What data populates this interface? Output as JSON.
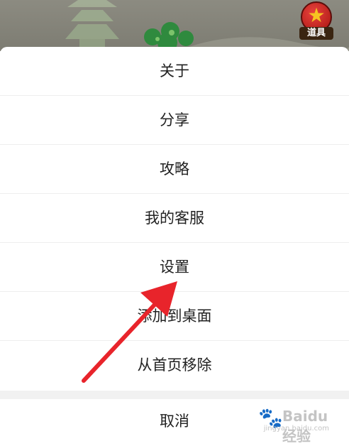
{
  "background": {
    "tools_badge_label": "道具"
  },
  "menu": {
    "items": [
      {
        "label": "关于"
      },
      {
        "label": "分享"
      },
      {
        "label": "攻略"
      },
      {
        "label": "我的客服"
      },
      {
        "label": "设置"
      },
      {
        "label": "添加到桌面"
      },
      {
        "label": "从首页移除"
      }
    ],
    "cancel_label": "取消"
  },
  "annotation": {
    "arrow_color": "#e8242b"
  },
  "watermark": {
    "brand": "Baidu 经验",
    "url": "jingyan.baidu.com"
  }
}
